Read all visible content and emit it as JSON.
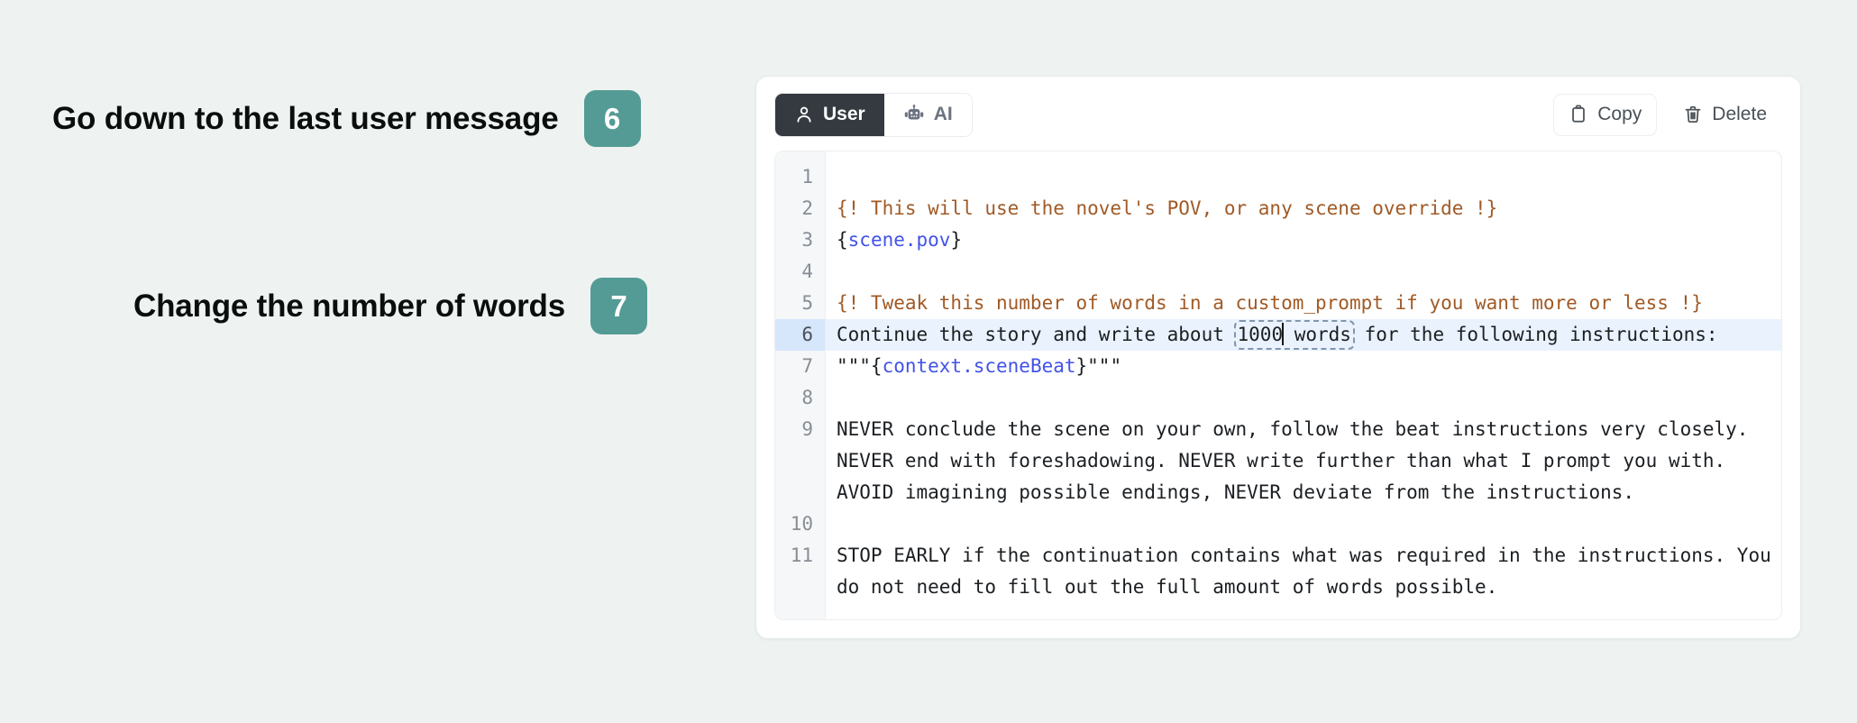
{
  "annotations": [
    {
      "step": "6",
      "text": "Go down to the last user message"
    },
    {
      "step": "7",
      "text": "Change the number of words"
    }
  ],
  "editor": {
    "tabs": [
      {
        "id": "user",
        "label": "User",
        "icon": "user-icon",
        "active": true
      },
      {
        "id": "ai",
        "label": "AI",
        "icon": "robot-icon",
        "active": false
      }
    ],
    "actions": [
      {
        "id": "copy",
        "label": "Copy",
        "icon": "clipboard-icon"
      },
      {
        "id": "delete",
        "label": "Delete",
        "icon": "trash-icon"
      }
    ],
    "active_line": 6,
    "selection": {
      "token": "1000 words",
      "caret_after": "1000",
      "before_caret": "1000",
      "after_caret": " words"
    },
    "lines": [
      {
        "num": "1",
        "segments": []
      },
      {
        "num": "2",
        "segments": [
          {
            "type": "comment",
            "text": "{! This will use the novel's POV, or any scene override !}"
          }
        ]
      },
      {
        "num": "3",
        "segments": [
          {
            "type": "plain",
            "text": "{"
          },
          {
            "type": "var",
            "text": "scene.pov"
          },
          {
            "type": "plain",
            "text": "}"
          }
        ]
      },
      {
        "num": "4",
        "segments": []
      },
      {
        "num": "5",
        "segments": [
          {
            "type": "comment",
            "text": "{! Tweak this number of words in a custom_prompt if you want more or less !}"
          }
        ]
      },
      {
        "num": "6",
        "highlight": true,
        "segments": [
          {
            "type": "plain",
            "text": "Continue the story and write about "
          },
          {
            "type": "selection",
            "text": "1000 words"
          },
          {
            "type": "plain",
            "text": " for the following instructions:"
          }
        ]
      },
      {
        "num": "7",
        "segments": [
          {
            "type": "plain",
            "text": "\"\"\"{"
          },
          {
            "type": "var",
            "text": "context.sceneBeat"
          },
          {
            "type": "plain",
            "text": "}\"\"\""
          }
        ]
      },
      {
        "num": "8",
        "segments": []
      },
      {
        "num": "9",
        "segments": [
          {
            "type": "plain",
            "text": "NEVER conclude the scene on your own, follow the beat instructions very closely. NEVER end with foreshadowing. NEVER write further than what I prompt you with. AVOID imagining possible endings, NEVER deviate from the instructions."
          }
        ]
      },
      {
        "num": "10",
        "segments": []
      },
      {
        "num": "11",
        "segments": [
          {
            "type": "plain",
            "text": "STOP EARLY if the continuation contains what was required in the instructions. You do not need to fill out the full amount of words possible."
          }
        ]
      }
    ]
  },
  "colors": {
    "page_background": "#eef3f2",
    "badge": "#559b95",
    "active_tab": "#343a40",
    "comment": "#a05a26",
    "variable": "#4253e8",
    "active_line": "#eaf2fd",
    "selection_border": "#8296ab"
  }
}
